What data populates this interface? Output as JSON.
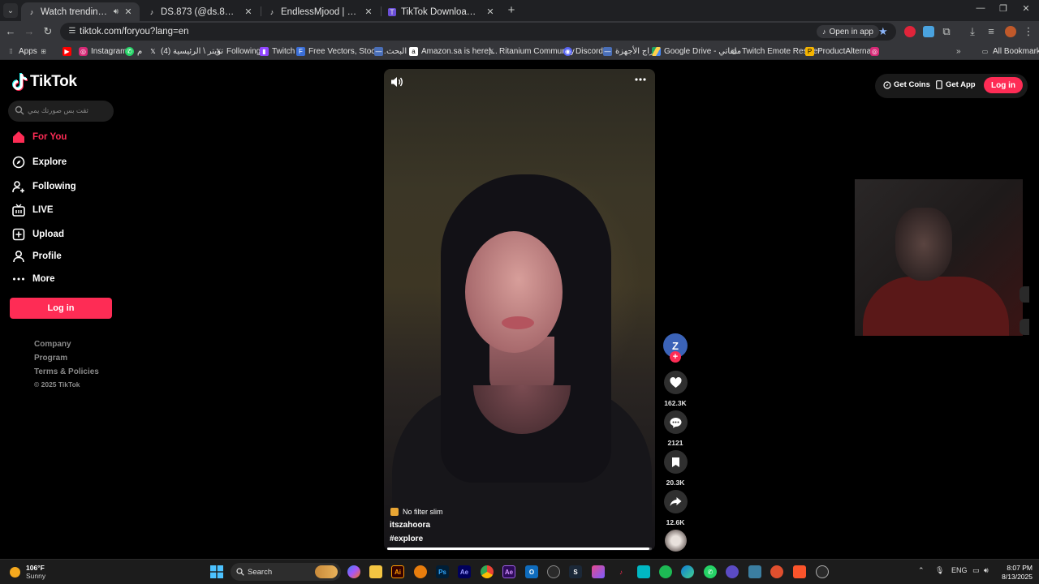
{
  "browser": {
    "tabs": [
      {
        "title": "Watch trending videos for y",
        "active": true
      },
      {
        "title": "DS.873 (@ds.873) | TikTok",
        "active": false
      },
      {
        "title": "EndlessMjood | (@endlessmjoo",
        "active": false
      },
      {
        "title": "TikTok Downloader - Downloa",
        "active": false
      }
    ],
    "url": "tiktok.com/foryou?lang=en",
    "open_in_app": "Open in app",
    "bookmarks": [
      "Apps",
      "Instagram",
      "م",
      "تويتر \\ الرئيسية (4)",
      "Following",
      "Twitch",
      "Free Vectors, Stock...",
      "البحث",
      "Amazon.sa is here|...",
      "Ritanium Community",
      "Discord",
      "حراج الأجهزة",
      "Google Drive - ملفاتي",
      "Twitch Emote Resizer",
      "ProductAlternate",
      "All Bookmarks"
    ]
  },
  "tiktok": {
    "logo": "TikTok",
    "search_placeholder": "ثقت بس صورتك يمي",
    "nav": [
      {
        "label": "For You",
        "icon": "home-icon",
        "active": true
      },
      {
        "label": "Explore",
        "icon": "compass-icon",
        "active": false
      },
      {
        "label": "Following",
        "icon": "following-icon",
        "active": false
      },
      {
        "label": "LIVE",
        "icon": "live-icon",
        "active": false
      },
      {
        "label": "Upload",
        "icon": "upload-icon",
        "active": false
      },
      {
        "label": "Profile",
        "icon": "profile-icon",
        "active": false
      },
      {
        "label": "More",
        "icon": "more-icon",
        "active": false
      }
    ],
    "login": "Log in",
    "footer": [
      "Company",
      "Program",
      "Terms & Policies",
      "© 2025 TikTok"
    ],
    "header": {
      "get_coins": "Get Coins",
      "get_app": "Get App",
      "login": "Log in"
    },
    "video": {
      "tag": "No filter slim",
      "username": "itszahoora",
      "hashtag": "#explore",
      "progress": 0.99,
      "avatar_letter": "Z"
    },
    "actions": {
      "likes": "162.3K",
      "comments": "2121",
      "saves": "20.3K",
      "shares": "12.6K"
    },
    "brand_color": "#fe2c55"
  },
  "taskbar": {
    "weather_temp": "106°F",
    "weather_desc": "Sunny",
    "search": "Search",
    "lang": "ENG",
    "time": "8:07 PM",
    "date": "8/13/2025"
  }
}
